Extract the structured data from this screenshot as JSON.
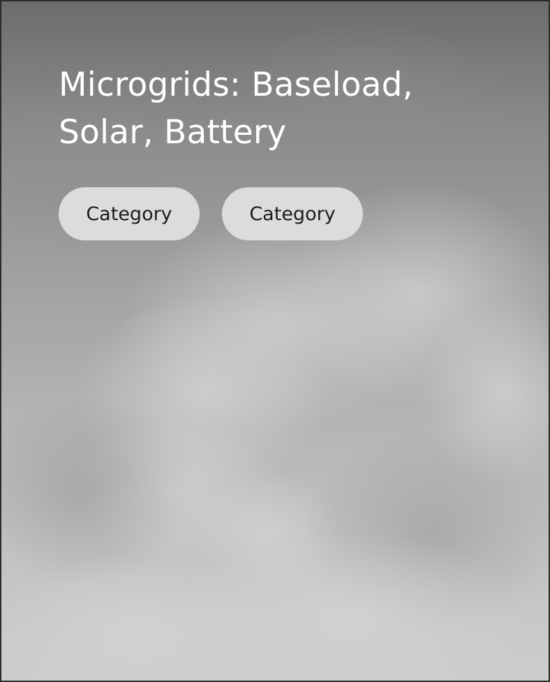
{
  "card": {
    "title": "Microgrids: Baseload, Solar, Battery",
    "tags": [
      {
        "label": "Category"
      },
      {
        "label": "Category"
      }
    ]
  },
  "background": {
    "image": "cloudy-sky-grayscale"
  }
}
